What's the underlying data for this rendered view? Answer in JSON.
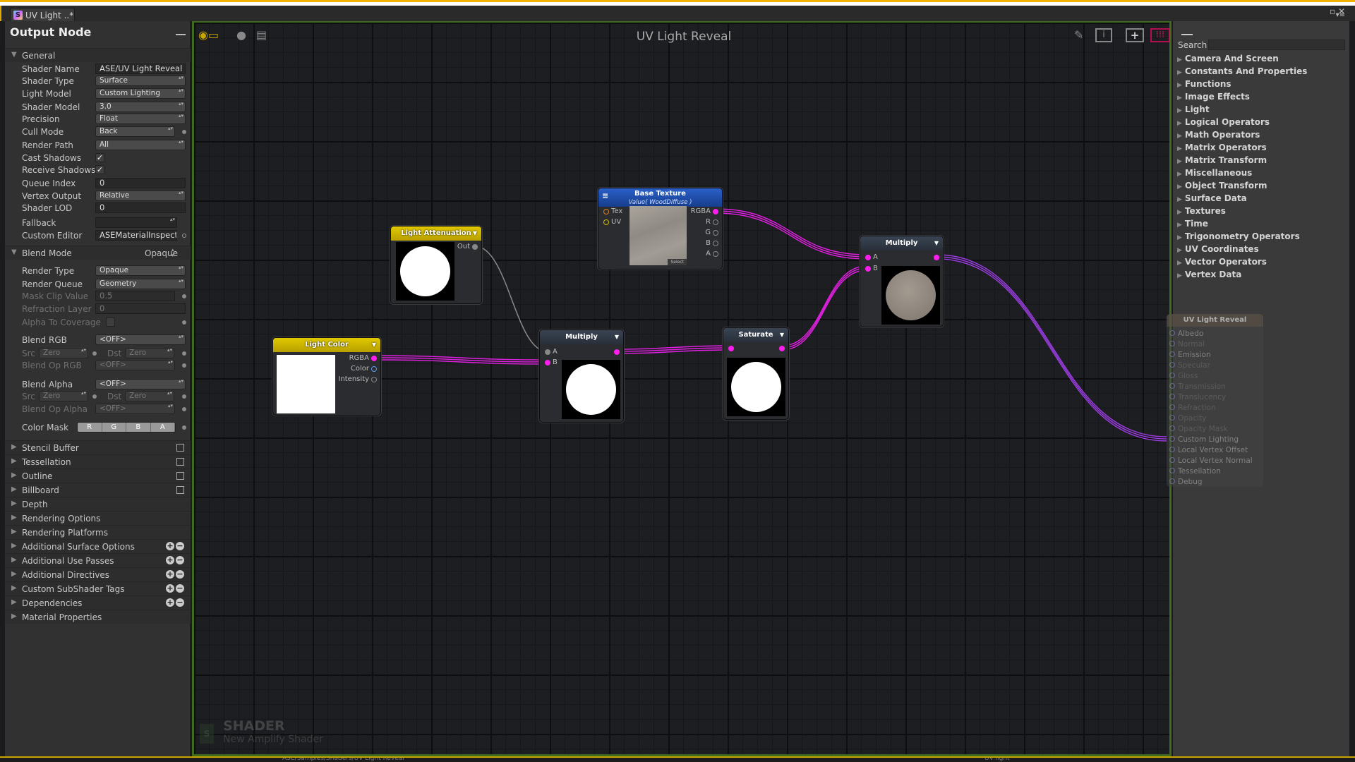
{
  "window": {
    "tab_title": "UV Light ..*",
    "tab_icon": "shader-s-icon"
  },
  "left_panel": {
    "title": "Output Node",
    "general": {
      "header": "General",
      "shader_name": {
        "label": "Shader Name",
        "value": "ASE/UV Light Reveal"
      },
      "shader_type": {
        "label": "Shader Type",
        "value": "Surface"
      },
      "light_model": {
        "label": "Light Model",
        "value": "Custom Lighting"
      },
      "shader_model": {
        "label": "Shader Model",
        "value": "3.0"
      },
      "precision": {
        "label": "Precision",
        "value": "Float"
      },
      "cull_mode": {
        "label": "Cull Mode",
        "value": "Back"
      },
      "render_path": {
        "label": "Render Path",
        "value": "All"
      },
      "cast_shadows": {
        "label": "Cast Shadows",
        "checked": true,
        "mark": "✓"
      },
      "receive_shadows": {
        "label": "Receive Shadows",
        "checked": true,
        "mark": "✓"
      },
      "queue_index": {
        "label": "Queue Index",
        "value": "0"
      },
      "vertex_output": {
        "label": "Vertex Output",
        "value": "Relative"
      },
      "shader_lod": {
        "label": "Shader LOD",
        "value": "0"
      },
      "fallback": {
        "label": "Fallback",
        "value": ""
      },
      "custom_editor": {
        "label": "Custom Editor",
        "value": "ASEMaterialInspector"
      }
    },
    "blend_mode": {
      "header": "Blend Mode",
      "value": "Opaque",
      "render_type": {
        "label": "Render Type",
        "value": "Opaque"
      },
      "render_queue": {
        "label": "Render Queue",
        "value": "Geometry"
      },
      "mask_clip": {
        "label": "Mask Clip Value",
        "value": "0.5"
      },
      "refraction_layer": {
        "label": "Refraction Layer",
        "value": "0"
      },
      "alpha_to_coverage": {
        "label": "Alpha To Coverage",
        "checked": false
      },
      "blend_rgb": {
        "label": "Blend RGB",
        "value": "<OFF>"
      },
      "src_label": "Src",
      "dst_label": "Dst",
      "src_value": "Zero",
      "dst_value": "Zero",
      "blend_op_rgb": {
        "label": "Blend Op RGB",
        "value": "<OFF>"
      },
      "blend_alpha": {
        "label": "Blend Alpha",
        "value": "<OFF>"
      },
      "blend_op_alpha": {
        "label": "Blend Op Alpha",
        "value": "<OFF>"
      },
      "color_mask": {
        "label": "Color Mask",
        "channels": [
          "R",
          "G",
          "B",
          "A"
        ]
      }
    },
    "sections": [
      "Stencil Buffer",
      "Tessellation",
      "Outline",
      "Billboard",
      "Depth",
      "Rendering Options",
      "Rendering Platforms",
      "Additional Surface Options",
      "Additional Use Passes",
      "Additional Directives",
      "Custom SubShader Tags",
      "Dependencies",
      "Material Properties"
    ],
    "plus": "+",
    "minus": "−"
  },
  "canvas": {
    "title": "UV Light Reveal",
    "watermark": {
      "title": "SHADER",
      "subtitle": "New Amplify Shader"
    },
    "nodes": {
      "light_attenuation": {
        "title": "Light Attenuation",
        "out": "Out"
      },
      "light_color": {
        "title": "Light Color",
        "ports": [
          "RGBA",
          "Color",
          "Intensity"
        ]
      },
      "base_texture": {
        "title": "Base Texture",
        "subtitle": "Value( WoodDiffuse )",
        "inputs": [
          "Tex",
          "UV"
        ],
        "outputs": [
          "RGBA",
          "R",
          "G",
          "B",
          "A"
        ],
        "select": "Select"
      },
      "multiply_1": {
        "title": "Multiply",
        "inputs": [
          "A",
          "B"
        ]
      },
      "saturate": {
        "title": "Saturate"
      },
      "multiply_2": {
        "title": "Multiply",
        "inputs": [
          "A",
          "B"
        ]
      },
      "output": {
        "title": "UV Light Reveal",
        "ports": [
          "Albedo",
          "Normal",
          "Emission",
          "Specular",
          "Gloss",
          "Transmission",
          "Translucency",
          "Refraction",
          "Opacity",
          "Opacity Mask",
          "Custom Lighting",
          "Local Vertex Offset",
          "Local Vertex Normal",
          "Tessellation",
          "Debug"
        ]
      }
    },
    "wire_color": "#e020e0"
  },
  "right_panel": {
    "search_label": "Search",
    "search_placeholder": "",
    "categories": [
      "Camera And Screen",
      "Constants And Properties",
      "Functions",
      "Image Effects",
      "Light",
      "Logical Operators",
      "Math Operators",
      "Matrix Operators",
      "Matrix Transform",
      "Miscellaneous",
      "Object Transform",
      "Surface Data",
      "Textures",
      "Time",
      "Trigonometry Operators",
      "UV Coordinates",
      "Vector Operators",
      "Vertex Data"
    ]
  },
  "bottom_bar": {
    "path": "ASE/Samples/Shaders/UV Light Reveal",
    "right": "UV light"
  }
}
